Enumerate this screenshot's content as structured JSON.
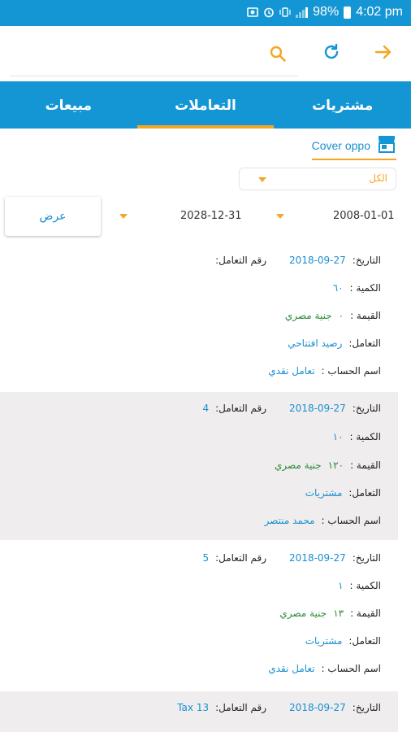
{
  "status_bar": {
    "battery": "98%",
    "time": "4:02 pm"
  },
  "toolbar": {
    "back_icon": "arrow-right-icon",
    "refresh_icon": "refresh-icon",
    "search_icon": "search-icon"
  },
  "tabs": [
    {
      "label": "مشتريات",
      "active": false
    },
    {
      "label": "التعاملات",
      "active": true
    },
    {
      "label": "مبيعات",
      "active": false
    }
  ],
  "store": {
    "name": "Cover oppo"
  },
  "filter": {
    "value": "الكل"
  },
  "date_range": {
    "from": "2008-01-01",
    "to": "2028-12-31",
    "show_label": "عرض"
  },
  "labels": {
    "date": "التاريخ:",
    "txn_no": "رقم التعامل:",
    "qty": "الكمية :",
    "value": "القيمة :",
    "dealer": "التعامل:",
    "account": "اسم الحساب :"
  },
  "transactions": [
    {
      "date": "2018-09-27",
      "txn_no": "",
      "qty": "٦٠",
      "value_num": "٠",
      "currency": "جنية مصري",
      "dealer": "رصيد افتتاحي",
      "account": "تعامل نقدي"
    },
    {
      "date": "2018-09-27",
      "txn_no": "4",
      "qty": "١٠",
      "value_num": "١٢٠",
      "currency": "جنية مصري",
      "dealer": "مشتريات",
      "account": "محمد منتصر"
    },
    {
      "date": "2018-09-27",
      "txn_no": "5",
      "qty": "١",
      "value_num": "١٣",
      "currency": "جنية مصري",
      "dealer": "مشتريات",
      "account": "تعامل نقدي"
    },
    {
      "date": "2018-09-27",
      "txn_no": "Tax 13",
      "qty": "",
      "value_num": "",
      "currency": "",
      "dealer": "",
      "account": ""
    }
  ],
  "colors": {
    "primary": "#1596d4",
    "accent": "#f5a623",
    "link": "#1a8fd0",
    "money": "#2e8b3a",
    "shaded_row": "#efedee"
  }
}
